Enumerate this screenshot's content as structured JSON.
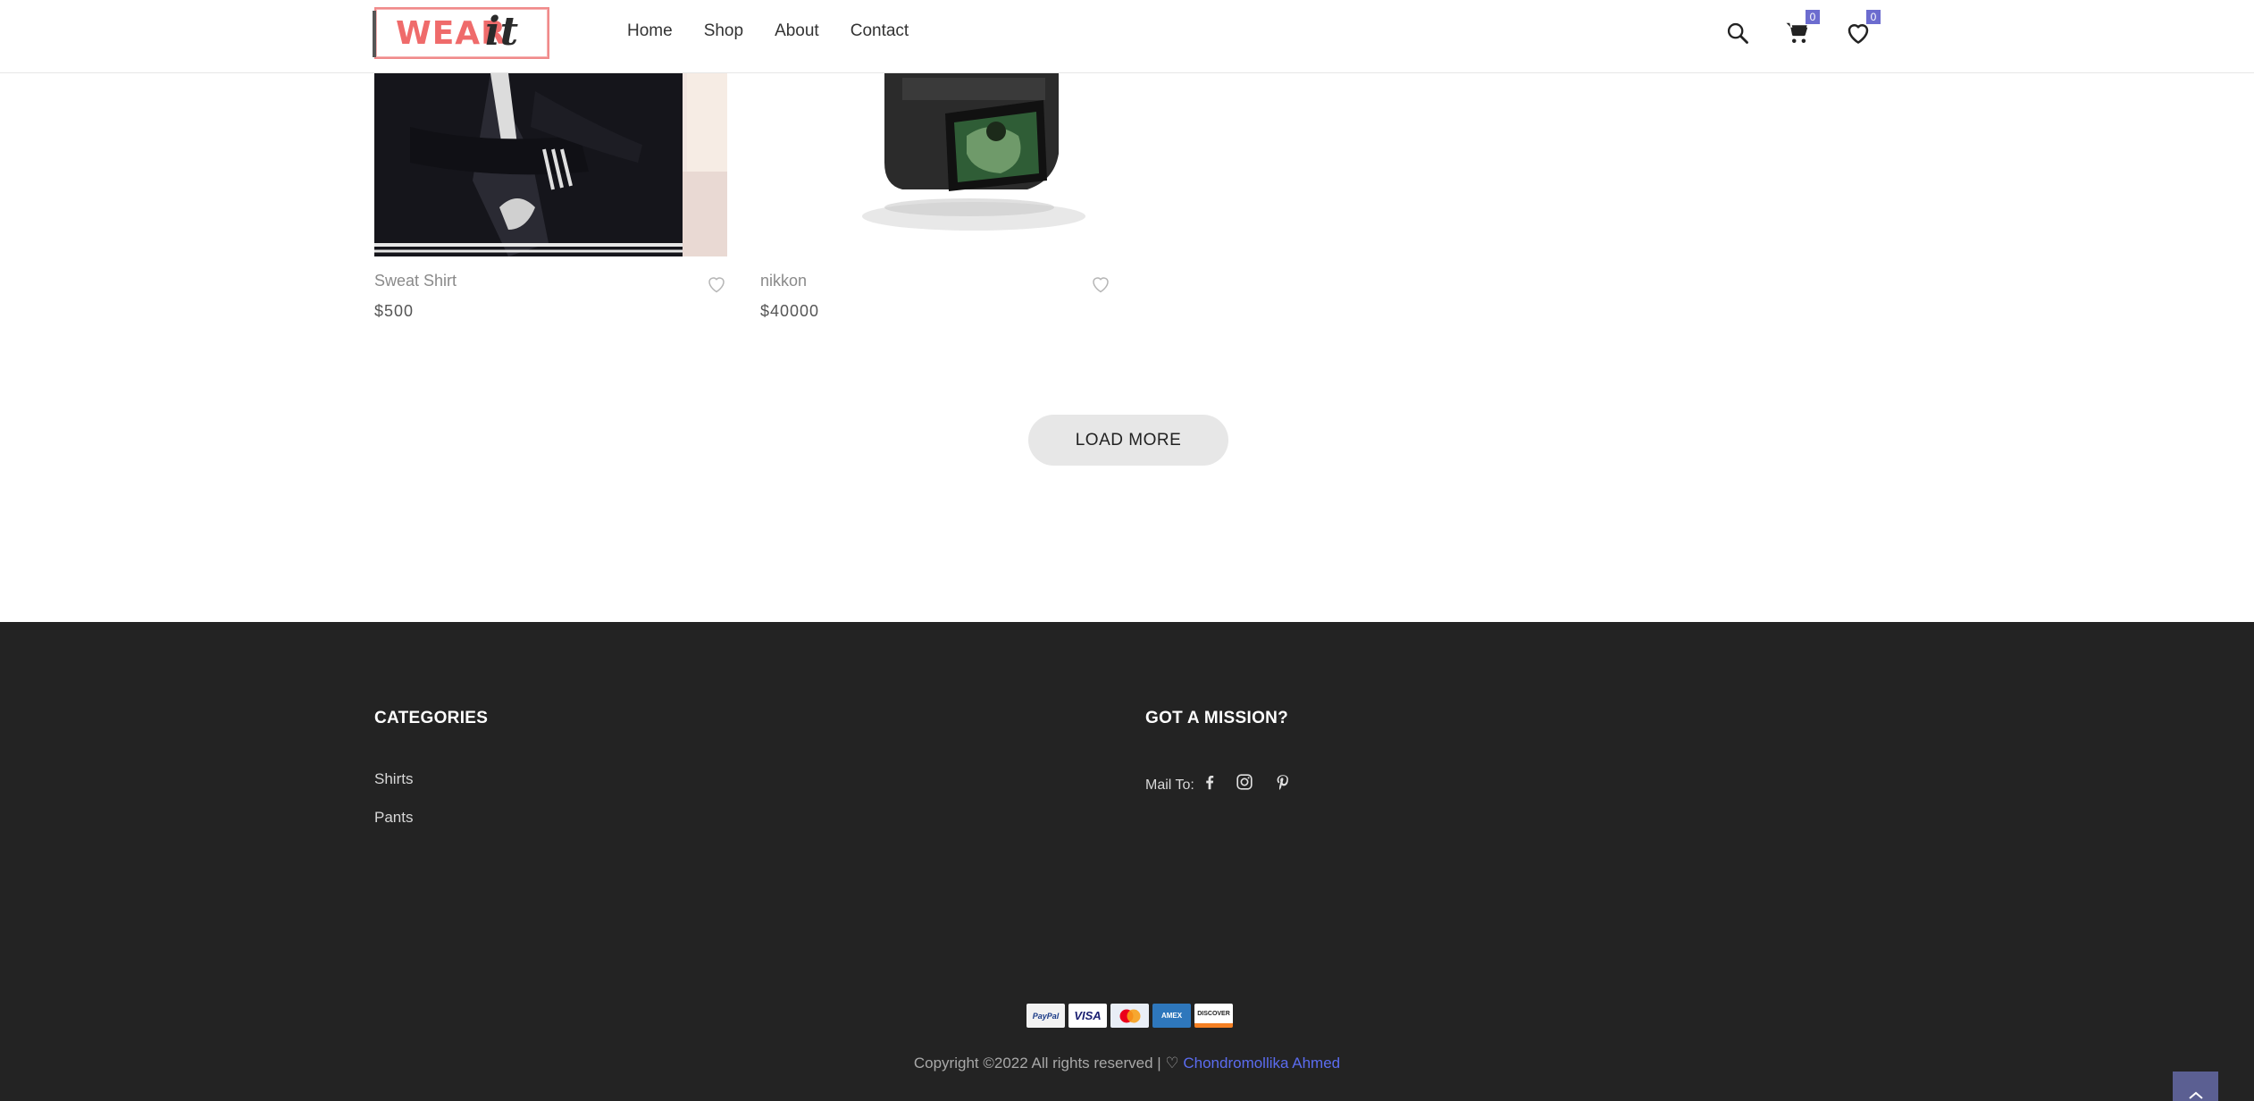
{
  "header": {
    "logo_word": "WEAR",
    "logo_script": "it",
    "nav": [
      "Home",
      "Shop",
      "About",
      "Contact"
    ],
    "cart_count": "0",
    "wishlist_count": "0",
    "icons": [
      "search-icon",
      "cart-icon",
      "heart-icon"
    ]
  },
  "products": [
    {
      "name": "Sweat Shirt",
      "price": "$500"
    },
    {
      "name": "nikkon",
      "price": "$40000"
    }
  ],
  "load_more": "LOAD MORE",
  "footer": {
    "categories_title": "CATEGORIES",
    "categories": [
      "Shirts",
      "Pants"
    ],
    "mission_title": "GOT A MISSION?",
    "mail_to": "Mail To:",
    "social_icons": [
      "facebook-icon",
      "instagram-icon",
      "pinterest-icon"
    ],
    "payments": [
      "PayPal",
      "VISA",
      "MasterCard",
      "AMEX",
      "DISCOVER"
    ],
    "copyright": "Copyright ©2022 All rights reserved | ♡ ",
    "author": "Chondromollika Ahmed"
  },
  "colors": {
    "accent": "#6c6ccf",
    "logo": "#ef6b6b",
    "footer_bg": "#232323",
    "author_link": "#5b6cf0"
  }
}
